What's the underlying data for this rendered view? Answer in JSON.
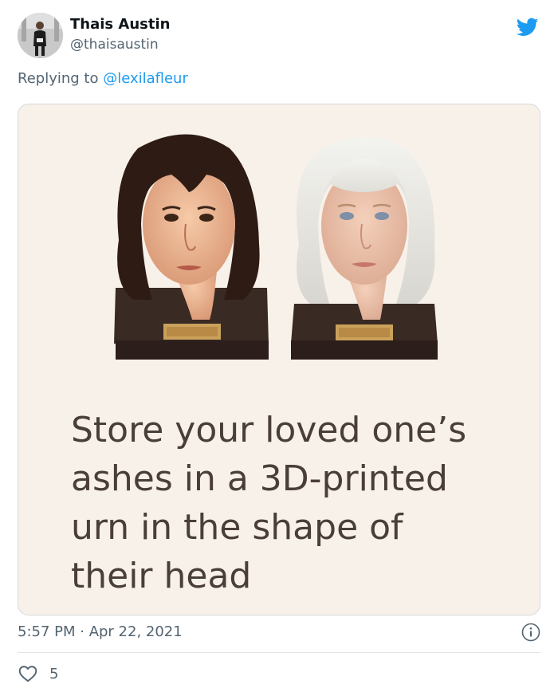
{
  "author": {
    "name": "Thais Austin",
    "handle": "@thaisaustin"
  },
  "reply": {
    "prefix": "Replying to ",
    "mention": "@lexilafleur"
  },
  "media": {
    "caption_lines": [
      "Store your loved one’s",
      "ashes in a 3D-printed",
      "urn in the shape of",
      "their head"
    ]
  },
  "meta": {
    "timestamp": "5:57 PM · Apr 22, 2021"
  },
  "engagement": {
    "like_count": "5"
  },
  "icons": {
    "brand": "twitter-bird-icon",
    "info": "info-icon",
    "like": "heart-icon"
  },
  "colors": {
    "twitter_blue": "#1d9bf0",
    "card_bg": "#f8f1ea",
    "caption_text": "#4a3f38"
  }
}
